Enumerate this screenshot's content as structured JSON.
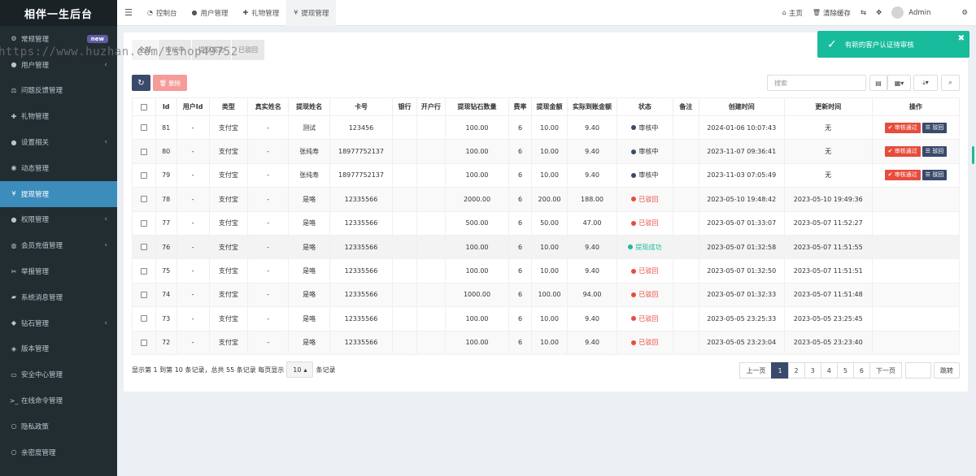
{
  "app": {
    "title": "相伴一生后台"
  },
  "sidebar": {
    "items": [
      {
        "label": "常规管理",
        "icon": "cogs-icon",
        "glyph": "⚙",
        "badge": "new",
        "chev": ""
      },
      {
        "label": "用户管理",
        "icon": "user-icon",
        "glyph": "●",
        "badge": "",
        "chev": "‹"
      },
      {
        "label": "问题反馈管理",
        "icon": "scale-icon",
        "glyph": "⚖",
        "badge": "",
        "chev": ""
      },
      {
        "label": "礼物管理",
        "icon": "gift-icon",
        "glyph": "✚",
        "badge": "",
        "chev": ""
      },
      {
        "label": "设置相关",
        "icon": "apple-icon",
        "glyph": "●",
        "badge": "",
        "chev": "‹"
      },
      {
        "label": "动态管理",
        "icon": "compass-icon",
        "glyph": "◉",
        "badge": "",
        "chev": ""
      },
      {
        "label": "提现管理",
        "icon": "yen-icon",
        "glyph": "¥",
        "badge": "",
        "chev": ""
      },
      {
        "label": "权限管理",
        "icon": "group-icon",
        "glyph": "●",
        "badge": "",
        "chev": "‹"
      },
      {
        "label": "会员充值管理",
        "icon": "globe-icon",
        "glyph": "◍",
        "badge": "",
        "chev": "‹"
      },
      {
        "label": "举报管理",
        "icon": "scissors-icon",
        "glyph": "✂",
        "badge": "",
        "chev": ""
      },
      {
        "label": "系统消息管理",
        "icon": "car-icon",
        "glyph": "▰",
        "badge": "",
        "chev": ""
      },
      {
        "label": "钻石管理",
        "icon": "diamond-icon",
        "glyph": "◆",
        "badge": "",
        "chev": "‹"
      },
      {
        "label": "版本管理",
        "icon": "cube-icon",
        "glyph": "◈",
        "badge": "",
        "chev": ""
      },
      {
        "label": "安全中心管理",
        "icon": "credit-card-icon",
        "glyph": "▭",
        "badge": "",
        "chev": ""
      },
      {
        "label": "在线命令管理",
        "icon": "terminal-icon",
        "glyph": ">_",
        "badge": "",
        "chev": ""
      },
      {
        "label": "隐私政策",
        "icon": "circle-icon",
        "glyph": "○",
        "badge": "",
        "chev": ""
      },
      {
        "label": "亲密度管理",
        "icon": "circle-icon",
        "glyph": "○",
        "badge": "",
        "chev": ""
      }
    ],
    "active_index": 6
  },
  "topbar": {
    "tabs": [
      {
        "label": "控制台",
        "icon": "dashboard-icon",
        "glyph": "◔"
      },
      {
        "label": "用户管理",
        "icon": "user-icon",
        "glyph": "●"
      },
      {
        "label": "礼物管理",
        "icon": "gift-icon",
        "glyph": "✚"
      },
      {
        "label": "提现管理",
        "icon": "yen-icon",
        "glyph": "¥"
      }
    ],
    "home": "主页",
    "clear_cache": "清除缓存",
    "admin": "Admin"
  },
  "subtabs": [
    "全部",
    "审核中",
    "提现成功",
    "已驳回"
  ],
  "toolbar": {
    "delete_label": "删除",
    "search_placeholder": "搜索"
  },
  "table": {
    "headers": [
      "Id",
      "用户Id",
      "类型",
      "真实姓名",
      "提现姓名",
      "卡号",
      "银行",
      "开户行",
      "提现钻石数量",
      "费率",
      "提现金额",
      "实际到账金额",
      "状态",
      "备注",
      "创建时间",
      "更新时间",
      "操作"
    ],
    "actions": {
      "approve": "审核通过",
      "reject": "驳回"
    },
    "rows": [
      {
        "id": "81",
        "uid": "-",
        "type": "支付宝",
        "real": "-",
        "name": "测试",
        "card": "123456",
        "bank": "",
        "branch": "",
        "diamonds": "100.00",
        "rate": "6",
        "amount": "10.00",
        "actual": "9.40",
        "status": "审核中",
        "status_kind": "review",
        "note": "",
        "created": "2024-01-06 10:07:43",
        "updated": "无",
        "has_actions": true
      },
      {
        "id": "80",
        "uid": "-",
        "type": "支付宝",
        "real": "-",
        "name": "张纯寿",
        "card": "18977752137",
        "bank": "",
        "branch": "",
        "diamonds": "100.00",
        "rate": "6",
        "amount": "10.00",
        "actual": "9.40",
        "status": "审核中",
        "status_kind": "review",
        "note": "",
        "created": "2023-11-07 09:36:41",
        "updated": "无",
        "has_actions": true
      },
      {
        "id": "79",
        "uid": "-",
        "type": "支付宝",
        "real": "-",
        "name": "张纯寿",
        "card": "18977752137",
        "bank": "",
        "branch": "",
        "diamonds": "100.00",
        "rate": "6",
        "amount": "10.00",
        "actual": "9.40",
        "status": "审核中",
        "status_kind": "review",
        "note": "",
        "created": "2023-11-03 07:05:49",
        "updated": "无",
        "has_actions": true
      },
      {
        "id": "78",
        "uid": "-",
        "type": "支付宝",
        "real": "-",
        "name": "是咯",
        "card": "12335566",
        "bank": "",
        "branch": "",
        "diamonds": "2000.00",
        "rate": "6",
        "amount": "200.00",
        "actual": "188.00",
        "status": "已驳回",
        "status_kind": "rejected",
        "note": "",
        "created": "2023-05-10 19:48:42",
        "updated": "2023-05-10 19:49:36",
        "has_actions": false
      },
      {
        "id": "77",
        "uid": "-",
        "type": "支付宝",
        "real": "-",
        "name": "是咯",
        "card": "12335566",
        "bank": "",
        "branch": "",
        "diamonds": "500.00",
        "rate": "6",
        "amount": "50.00",
        "actual": "47.00",
        "status": "已驳回",
        "status_kind": "rejected",
        "note": "",
        "created": "2023-05-07 01:33:07",
        "updated": "2023-05-07 11:52:27",
        "has_actions": false
      },
      {
        "id": "76",
        "uid": "-",
        "type": "支付宝",
        "real": "-",
        "name": "是咯",
        "card": "12335566",
        "bank": "",
        "branch": "",
        "diamonds": "100.00",
        "rate": "6",
        "amount": "10.00",
        "actual": "9.40",
        "status": "提现成功",
        "status_kind": "success",
        "note": "",
        "created": "2023-05-07 01:32:58",
        "updated": "2023-05-07 11:51:55",
        "has_actions": false
      },
      {
        "id": "75",
        "uid": "-",
        "type": "支付宝",
        "real": "-",
        "name": "是咯",
        "card": "12335566",
        "bank": "",
        "branch": "",
        "diamonds": "100.00",
        "rate": "6",
        "amount": "10.00",
        "actual": "9.40",
        "status": "已驳回",
        "status_kind": "rejected",
        "note": "",
        "created": "2023-05-07 01:32:50",
        "updated": "2023-05-07 11:51:51",
        "has_actions": false
      },
      {
        "id": "74",
        "uid": "-",
        "type": "支付宝",
        "real": "-",
        "name": "是咯",
        "card": "12335566",
        "bank": "",
        "branch": "",
        "diamonds": "1000.00",
        "rate": "6",
        "amount": "100.00",
        "actual": "94.00",
        "status": "已驳回",
        "status_kind": "rejected",
        "note": "",
        "created": "2023-05-07 01:32:33",
        "updated": "2023-05-07 11:51:48",
        "has_actions": false
      },
      {
        "id": "73",
        "uid": "-",
        "type": "支付宝",
        "real": "-",
        "name": "是咯",
        "card": "12335566",
        "bank": "",
        "branch": "",
        "diamonds": "100.00",
        "rate": "6",
        "amount": "10.00",
        "actual": "9.40",
        "status": "已驳回",
        "status_kind": "rejected",
        "note": "",
        "created": "2023-05-05 23:25:33",
        "updated": "2023-05-05 23:25:45",
        "has_actions": false
      },
      {
        "id": "72",
        "uid": "-",
        "type": "支付宝",
        "real": "-",
        "name": "是咯",
        "card": "12335566",
        "bank": "",
        "branch": "",
        "diamonds": "100.00",
        "rate": "6",
        "amount": "10.00",
        "actual": "9.40",
        "status": "已驳回",
        "status_kind": "rejected",
        "note": "",
        "created": "2023-05-05 23:23:04",
        "updated": "2023-05-05 23:23:40",
        "has_actions": false
      }
    ]
  },
  "pagination": {
    "info_prefix": "显示第 1 到第 10 条记录，总共 55 条记录 每页显示",
    "page_size": "10",
    "info_suffix": "条记录",
    "prev": "上一页",
    "next": "下一页",
    "pages": [
      "1",
      "2",
      "3",
      "4",
      "5",
      "6"
    ],
    "current": "1",
    "jump": "跳转"
  },
  "toast": {
    "message": "有新的客户认证待审核"
  },
  "watermark": "https://www.huzhan.com/ishop49752",
  "colors": {
    "sidebar_bg": "#222d32",
    "active": "#3c8dbc",
    "primary": "#3a4a6b",
    "danger": "#e74c3c",
    "success": "#18bc9c"
  }
}
